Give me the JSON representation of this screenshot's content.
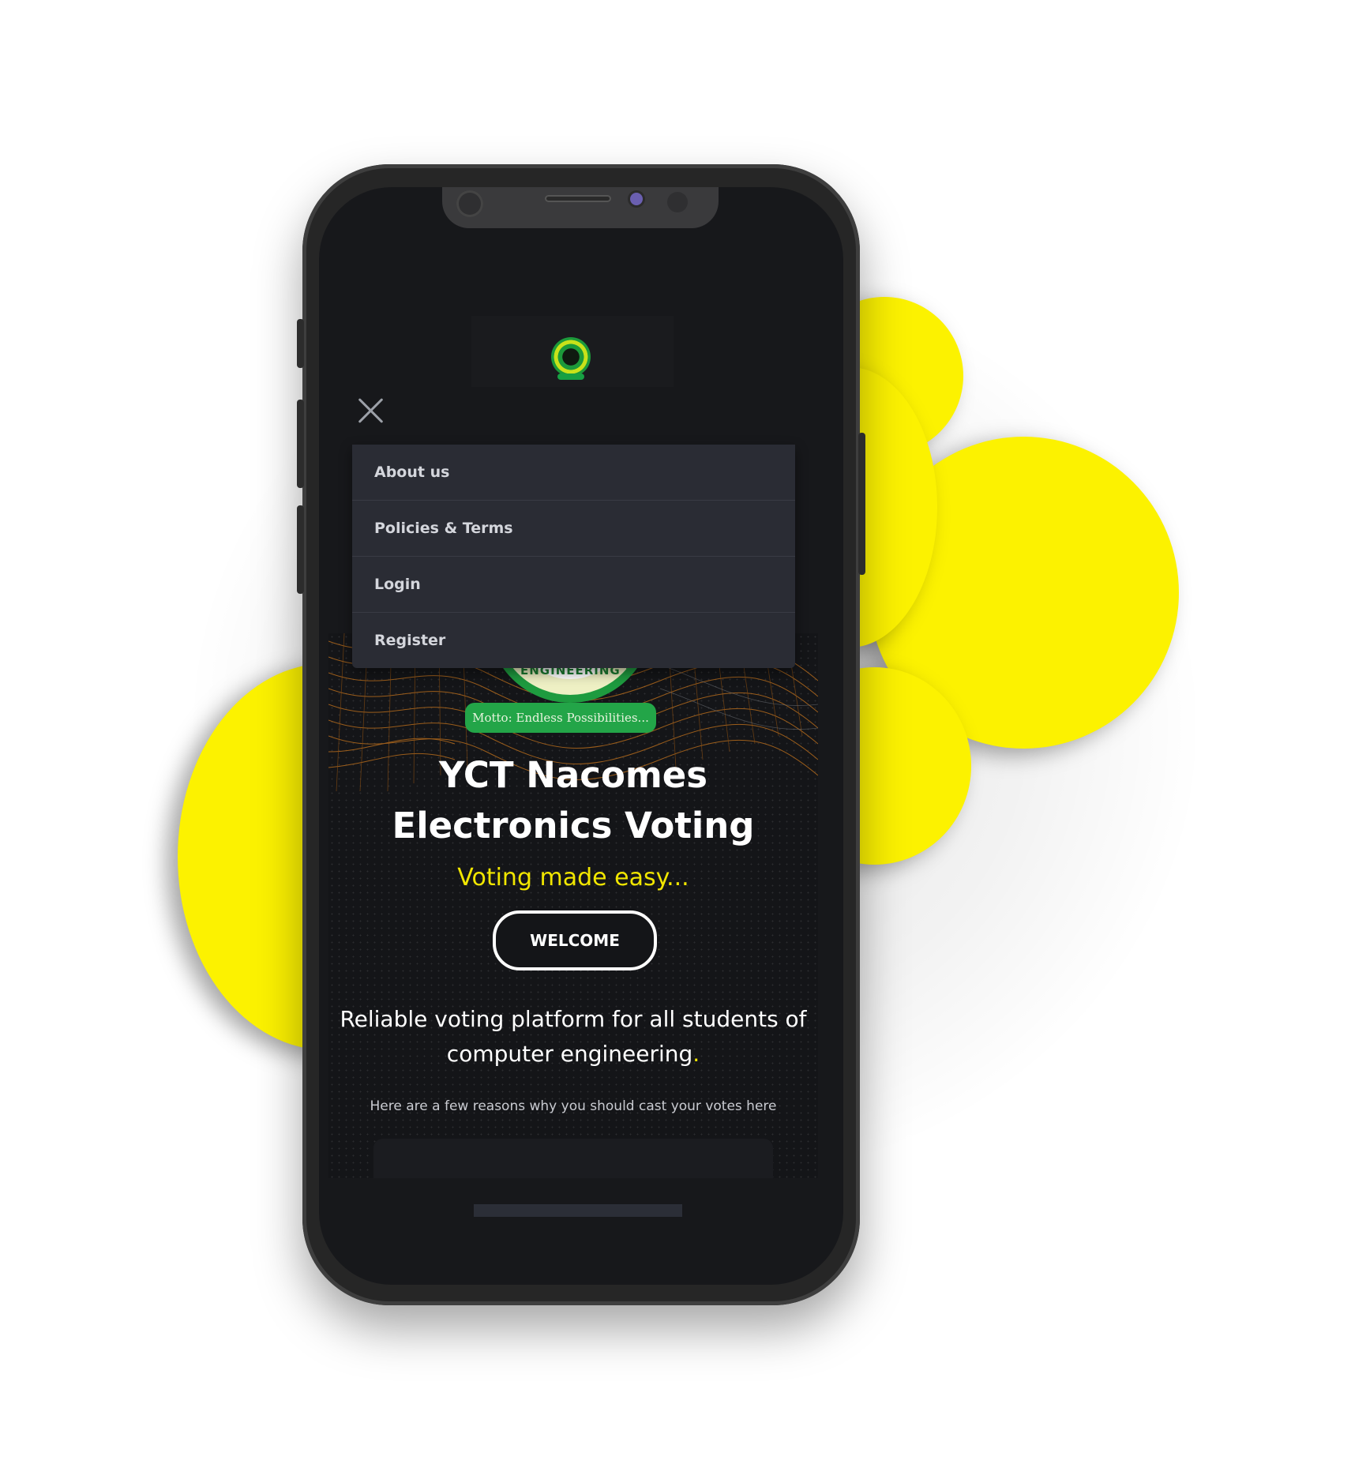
{
  "theme": {
    "accent": "#F1E600",
    "blob": "#FCF200",
    "screen_bg": "#17181b",
    "menu_bg": "#2a2c34"
  },
  "nav": {
    "logo_icon": "nacomes-logo-icon",
    "close_icon": "close-icon",
    "menu": [
      {
        "label": "About us"
      },
      {
        "label": "Policies & Terms"
      },
      {
        "label": "Login"
      },
      {
        "label": "Register"
      }
    ]
  },
  "hero": {
    "emblem_text": "ER ENGINEERING ST",
    "motto": "Motto: Endless Possibilities...",
    "title_line1": "YCT Nacomes",
    "title_line2": "Electronics Voting",
    "tagline": "Voting made easy...",
    "welcome_button": "WELCOME",
    "description_line1": "Reliable voting platform for all students of",
    "description_line2": "computer engineering",
    "description_end": ".",
    "reasons": "Here are a few reasons why you should cast your votes here"
  }
}
